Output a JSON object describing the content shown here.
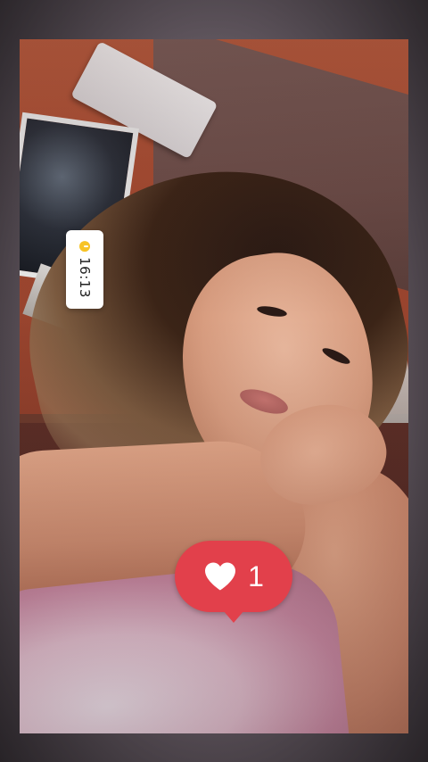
{
  "story": {
    "time_sticker": {
      "icon": "clock-icon",
      "time": "16:13",
      "icon_color": "#f7c325"
    },
    "like_sticker": {
      "icon": "heart-icon",
      "count": "1",
      "color": "#e2404b"
    }
  }
}
